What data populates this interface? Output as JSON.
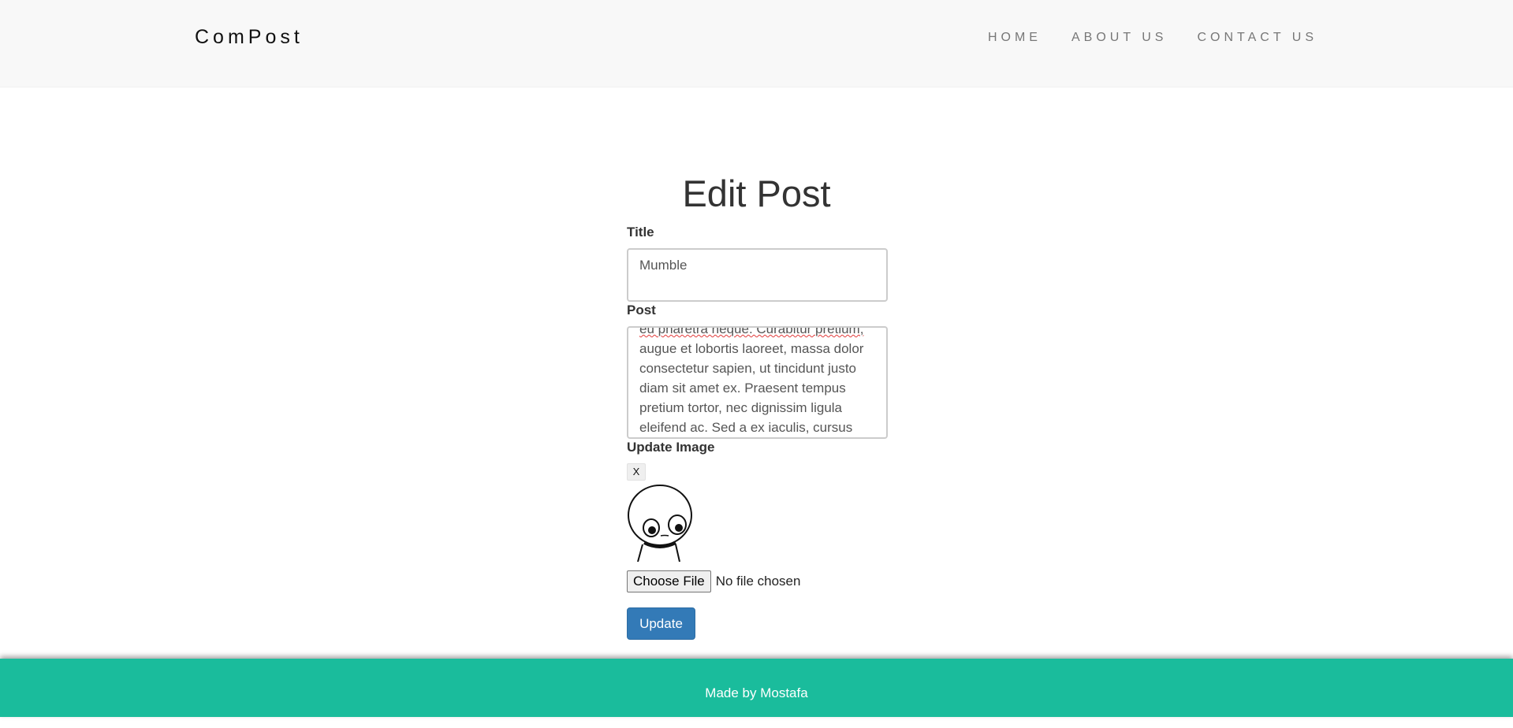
{
  "header": {
    "brand": "ComPost",
    "nav": [
      {
        "label": "HOME"
      },
      {
        "label": "ABOUT US"
      },
      {
        "label": "CONTACT US"
      }
    ]
  },
  "page_title": "Edit Post",
  "form": {
    "title_label": "Title",
    "title_value": "Mumble",
    "post_label": "Post",
    "post_lines": [
      "eu pharetra neque. Curabitur pretium,",
      "augue et lobortis laoreet, massa dolor",
      "consectetur sapien, ut tincidunt justo",
      "diam sit amet ex. Praesent tempus",
      "pretium tortor, nec dignissim ligula",
      "eleifend ac. Sed a ex iaculis, cursus"
    ],
    "image_label": "Update Image",
    "remove_image_label": "X",
    "choose_file_label": "Choose File",
    "file_status": "No file chosen",
    "submit_label": "Update"
  },
  "footer": {
    "text": "Made by Mostafa"
  }
}
